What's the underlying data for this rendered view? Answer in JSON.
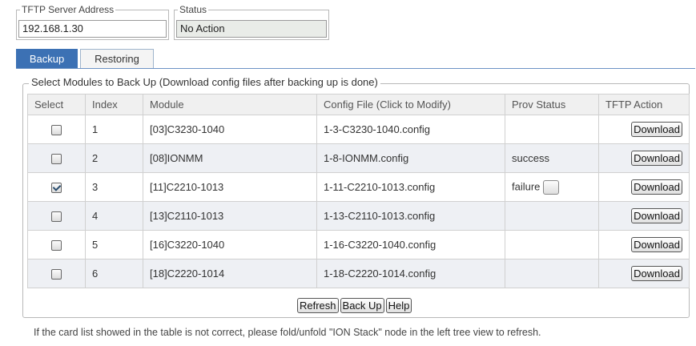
{
  "tftp": {
    "legend": "TFTP Server Address",
    "value": "192.168.1.30"
  },
  "status": {
    "legend": "Status",
    "value": "No Action"
  },
  "tabs": [
    {
      "label": "Backup",
      "active": true
    },
    {
      "label": "Restoring",
      "active": false
    }
  ],
  "panel": {
    "legend": "Select Modules to Back Up (Download config files after backing up is done)",
    "columns": [
      "Select",
      "Index",
      "Module",
      "Config File (Click to Modify)",
      "Prov Status",
      "TFTP Action"
    ],
    "rows": [
      {
        "checked": false,
        "index": "1",
        "module": "[03]C3230-1040",
        "config": "1-3-C3230-1040.config",
        "prov_status": "",
        "action": "Download"
      },
      {
        "checked": false,
        "index": "2",
        "module": "[08]IONMM",
        "config": "1-8-IONMM.config",
        "prov_status": "success",
        "action": "Download"
      },
      {
        "checked": true,
        "index": "3",
        "module": "[11]C2210-1013",
        "config": "1-11-C2210-1013.config",
        "prov_status": "failure",
        "action": "Download"
      },
      {
        "checked": false,
        "index": "4",
        "module": "[13]C2110-1013",
        "config": "1-13-C2110-1013.config",
        "prov_status": "",
        "action": "Download"
      },
      {
        "checked": false,
        "index": "5",
        "module": "[16]C3220-1040",
        "config": "1-16-C3220-1040.config",
        "prov_status": "",
        "action": "Download"
      },
      {
        "checked": false,
        "index": "6",
        "module": "[18]C2220-1014",
        "config": "1-18-C2220-1014.config",
        "prov_status": "",
        "action": "Download"
      }
    ]
  },
  "buttons": {
    "refresh": "Refresh",
    "backup": "Back Up",
    "help": "Help"
  },
  "footer_note": "If the card list showed in the table is not correct, please fold/unfold \"ION Stack\" node in the left tree view to refresh.",
  "colors": {
    "tab_active": "#3c71b4",
    "row_alt": "#eef0f4"
  }
}
